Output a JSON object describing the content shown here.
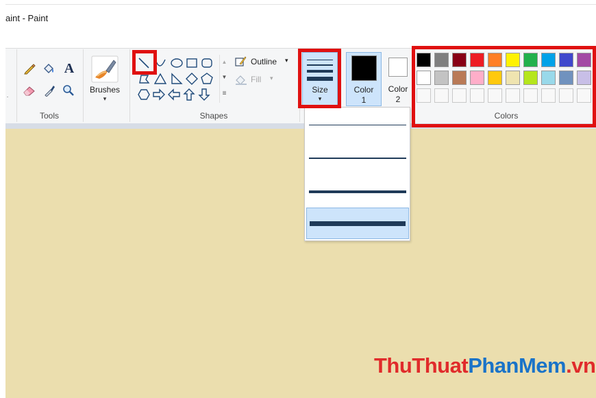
{
  "window": {
    "title": "aint - Paint"
  },
  "tools": {
    "group_label": "Tools",
    "icons": [
      "pencil-icon",
      "fill-bucket-icon",
      "text-icon",
      "eraser-icon",
      "color-picker-icon",
      "magnifier-icon"
    ],
    "text_glyph": "A"
  },
  "brushes": {
    "label": "Brushes",
    "arrow": "▾"
  },
  "shapes": {
    "group_label": "Shapes",
    "outline_label": "Outline",
    "outline_arrow": "▾",
    "fill_label": "Fill",
    "fill_arrow": "▾",
    "selected_shape": "line"
  },
  "size": {
    "label": "Size",
    "arrow": "▾",
    "options_count": 4,
    "selected_option": 4
  },
  "color1": {
    "label_line1": "Color",
    "label_line2": "1",
    "color": "#000000"
  },
  "color2": {
    "label_line1": "Color",
    "label_line2": "2",
    "color": "#ffffff"
  },
  "colors": {
    "group_label": "Colors",
    "row1": [
      "#000000",
      "#7f7f7f",
      "#880015",
      "#ed1c24",
      "#ff7f27",
      "#fff200",
      "#22b14c",
      "#00a2e8",
      "#3f48cc",
      "#a349a4"
    ],
    "row2": [
      "#ffffff",
      "#c3c3c3",
      "#b97a57",
      "#ffaec9",
      "#ffc90e",
      "#efe4b0",
      "#b5e61d",
      "#99d9ea",
      "#7092be",
      "#c8bfe7"
    ]
  },
  "canvas": {
    "background": "#ebdeae"
  },
  "watermark": {
    "part1": "ThuThuat",
    "part2": "PhanMem",
    "part3": ".vn"
  }
}
